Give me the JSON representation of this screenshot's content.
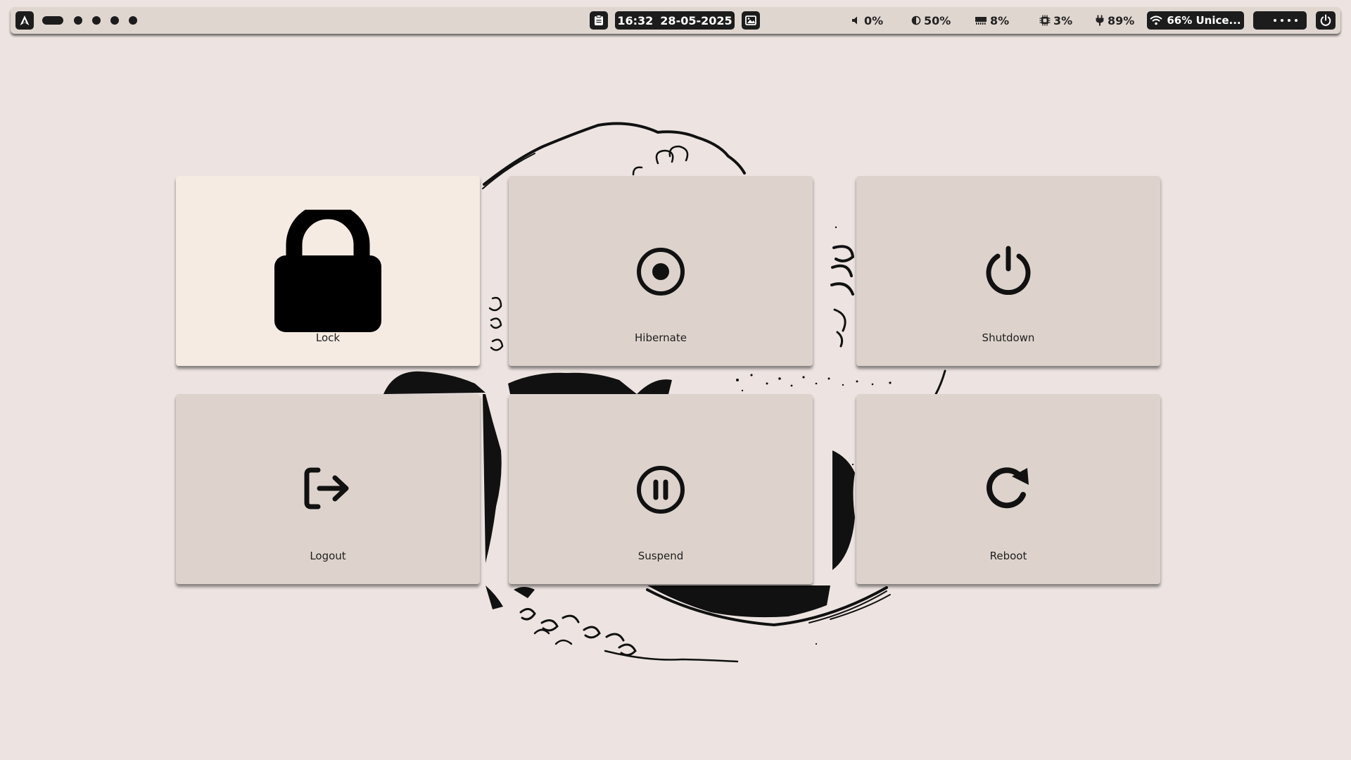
{
  "topbar": {
    "launcher_icon": "arch-logo-icon",
    "clipboard_icon": "clipboard-icon",
    "clock": {
      "time": "16:32",
      "date": "28-05-2025"
    },
    "wallpaper_icon": "image-icon",
    "volume": {
      "icon": "speaker-icon",
      "value": "0%"
    },
    "brightness": {
      "icon": "brightness-icon",
      "value": "50%"
    },
    "memory": {
      "icon": "ram-icon",
      "value": "8%"
    },
    "cpu": {
      "icon": "cpu-icon",
      "value": "3%"
    },
    "battery": {
      "icon": "power-plug-icon",
      "value": "89%"
    },
    "wifi": {
      "icon": "wifi-icon",
      "value": "66% Unice..."
    },
    "tray_icon": "moon-icon",
    "power_icon": "power-icon"
  },
  "workspaces": {
    "count": 5,
    "active": 1
  },
  "power_menu": {
    "items": [
      {
        "label": "Lock",
        "icon": "lock-icon",
        "selected": true
      },
      {
        "label": "Hibernate",
        "icon": "hibernate-icon",
        "selected": false
      },
      {
        "label": "Shutdown",
        "icon": "power-icon",
        "selected": false
      },
      {
        "label": "Logout",
        "icon": "logout-icon",
        "selected": false
      },
      {
        "label": "Suspend",
        "icon": "pause-icon",
        "selected": false
      },
      {
        "label": "Reboot",
        "icon": "reboot-icon",
        "selected": false
      }
    ]
  },
  "colors": {
    "background": "#ede4e1",
    "bar": "#e0d6d0",
    "card": "#ddd3cc",
    "card_selected": "#f5ebe3",
    "ink": "#1c1c1c"
  }
}
